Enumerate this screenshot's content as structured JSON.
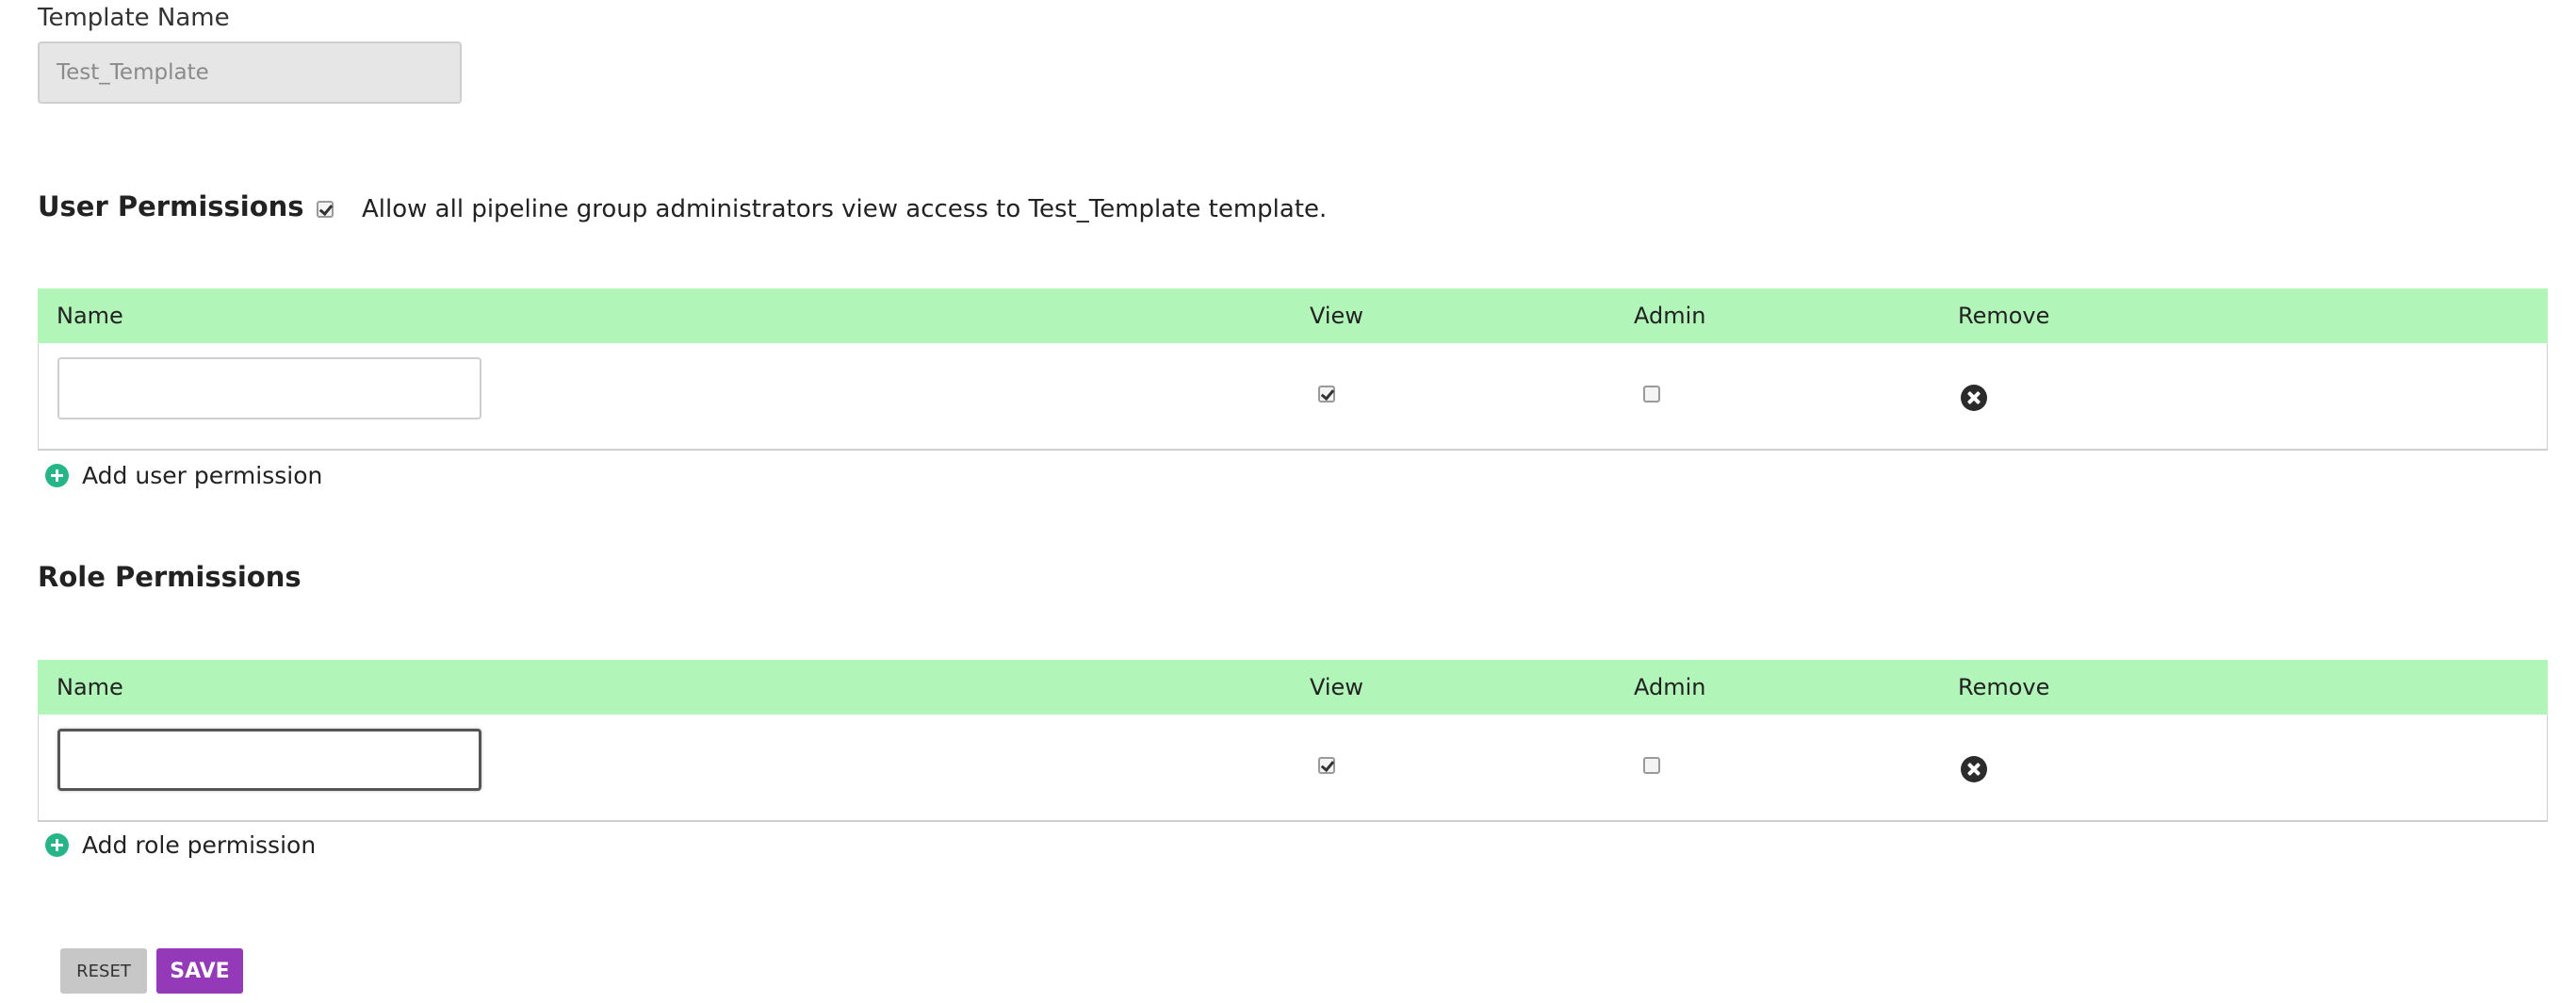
{
  "template_name": {
    "label": "Template Name",
    "value": "Test_Template"
  },
  "user_permissions": {
    "title": "User Permissions",
    "allow_admins_checked": true,
    "allow_admins_text": "Allow all pipeline group administrators view access to Test_Template template.",
    "columns": [
      "Name",
      "View",
      "Admin",
      "Remove"
    ],
    "rows": [
      {
        "name": "",
        "view": true,
        "admin": false
      }
    ],
    "add_label": "Add user permission"
  },
  "role_permissions": {
    "title": "Role Permissions",
    "columns": [
      "Name",
      "View",
      "Admin",
      "Remove"
    ],
    "rows": [
      {
        "name": "",
        "view": true,
        "admin": false
      }
    ],
    "add_label": "Add role permission"
  },
  "actions": {
    "reset_label": "RESET",
    "save_label": "SAVE"
  },
  "colors": {
    "table_header_bg": "#b2f5b9",
    "add_icon": "#26b589",
    "save_button": "#943ab8",
    "reset_button": "#c7c7c7"
  }
}
